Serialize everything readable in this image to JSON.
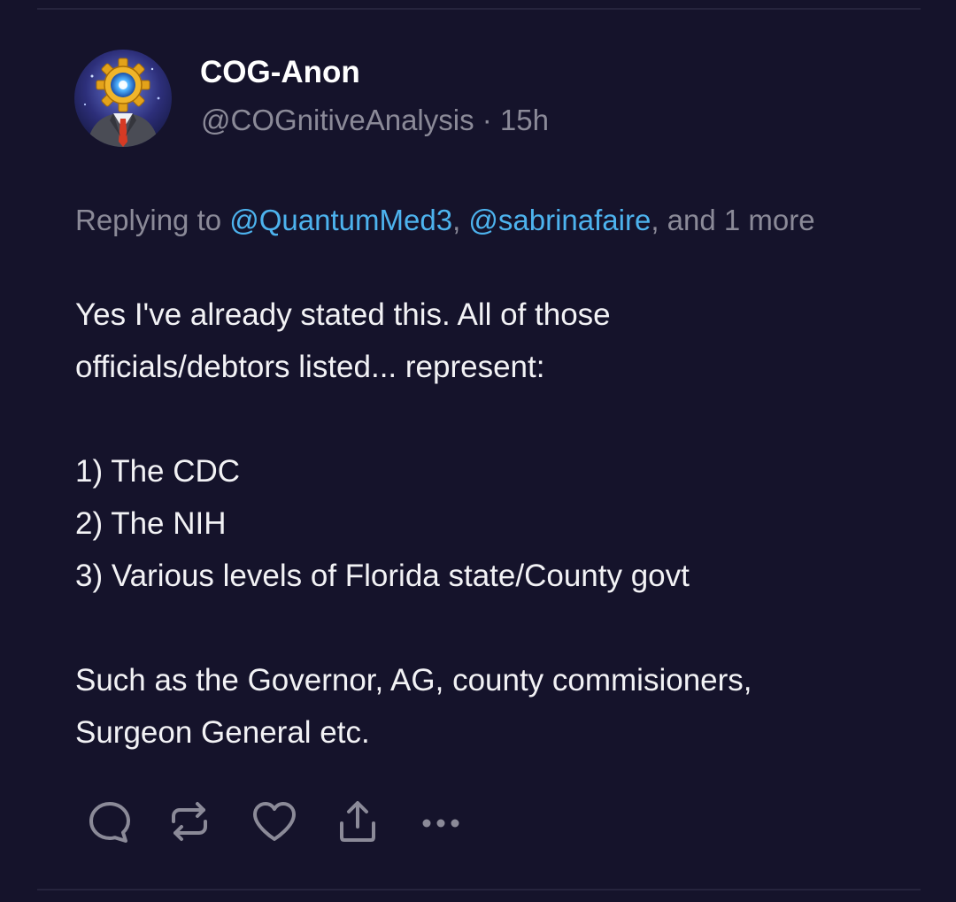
{
  "post": {
    "author": {
      "display_name": "COG-Anon",
      "handle": "@COGnitiveAnalysis",
      "separator": " · ",
      "timestamp": "15h",
      "avatar_icon": "gear-head-avatar"
    },
    "reply_context": {
      "prefix": "Replying to ",
      "mentions": [
        "@QuantumMed3",
        "@sabrinafaire"
      ],
      "joiner": ", ",
      "suffix": ", and 1 more"
    },
    "body_lines": [
      "Yes I've already stated this. All of those",
      "officials/debtors listed... represent:",
      "",
      "1) The CDC",
      "2) The NIH",
      "3) Various levels of Florida state/County govt",
      "",
      "Such as the Governor, AG, county commisioners,",
      "Surgeon General etc."
    ],
    "actions": [
      {
        "name": "reply",
        "icon": "reply-icon"
      },
      {
        "name": "repost",
        "icon": "repost-icon"
      },
      {
        "name": "like",
        "icon": "heart-icon"
      },
      {
        "name": "share",
        "icon": "share-icon"
      },
      {
        "name": "more",
        "icon": "more-icon"
      }
    ]
  },
  "colors": {
    "background": "#15132b",
    "text": "#f2f2f5",
    "muted": "#8b8a98",
    "link": "#4db3ee",
    "divider": "#26243d"
  }
}
